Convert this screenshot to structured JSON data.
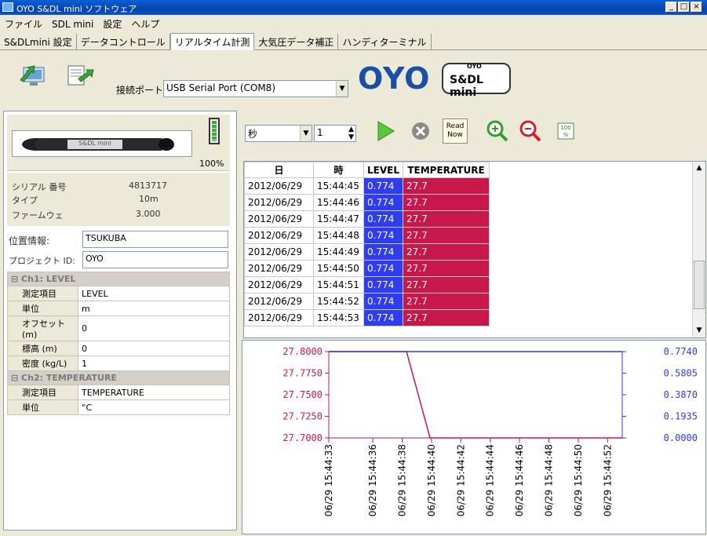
{
  "window": {
    "title": "OYO S&DL mini ソフトウェア",
    "buttons": [
      "_",
      "□",
      "×"
    ]
  },
  "menu": [
    "ファイル",
    "SDL mini",
    "設定",
    "ヘルプ"
  ],
  "tabs": [
    {
      "label": "S&DLmini 設定",
      "active": false
    },
    {
      "label": "データコントロール",
      "active": false
    },
    {
      "label": "リアルタイム計測",
      "active": true
    },
    {
      "label": "大気圧データ補正",
      "active": false
    },
    {
      "label": "ハンディターミナル",
      "active": false
    }
  ],
  "toolbar": {
    "port_label": "接続ポート",
    "port_value": "USB Serial Port (COM8)",
    "logo_text": "OYO",
    "badge_top": "OYO",
    "badge_text": "S&DL mini"
  },
  "device": {
    "battery": "100%",
    "image_label": "S&DL mini",
    "serial_label": "シリアル 番号",
    "serial": "4813717",
    "type_label": "タイプ",
    "type": "10m",
    "firmware_label": "ファームウェ",
    "firmware": "3.000",
    "location_label": "位置情報:",
    "location": "TSUKUBA",
    "project_label": "プロジェクト ID:",
    "project": "OYO"
  },
  "properties": [
    {
      "group": "Ch1: LEVEL"
    },
    {
      "name": "測定項目",
      "value": "LEVEL"
    },
    {
      "name": "単位",
      "value": "m"
    },
    {
      "name": "オフセット (m)",
      "value": "0"
    },
    {
      "name": "標高 (m)",
      "value": "0"
    },
    {
      "name": "密度 (kg/L)",
      "value": "1"
    },
    {
      "group": "Ch2: TEMPERATURE"
    },
    {
      "name": "測定項目",
      "value": "TEMPERATURE"
    },
    {
      "name": "単位",
      "value": "°C"
    }
  ],
  "controls": {
    "unit": "秒",
    "interval": "1",
    "read_now": "Read Now"
  },
  "table": {
    "headers": [
      "日",
      "時",
      "LEVEL",
      "TEMPERATURE"
    ],
    "rows": [
      [
        "2012/06/29",
        "15:44:45",
        "0.774",
        "27.7"
      ],
      [
        "2012/06/29",
        "15:44:46",
        "0.774",
        "27.7"
      ],
      [
        "2012/06/29",
        "15:44:47",
        "0.774",
        "27.7"
      ],
      [
        "2012/06/29",
        "15:44:48",
        "0.774",
        "27.7"
      ],
      [
        "2012/06/29",
        "15:44:49",
        "0.774",
        "27.7"
      ],
      [
        "2012/06/29",
        "15:44:50",
        "0.774",
        "27.7"
      ],
      [
        "2012/06/29",
        "15:44:51",
        "0.774",
        "27.7"
      ],
      [
        "2012/06/29",
        "15:44:52",
        "0.774",
        "27.7"
      ],
      [
        "2012/06/29",
        "15:44:53",
        "0.774",
        "27.7"
      ]
    ]
  },
  "colors": {
    "level": "#2f3cf0",
    "temperature": "#c8174a",
    "accent": "#1a4fa6"
  },
  "chart_data": {
    "type": "line",
    "left_ticks": [
      "27.8000",
      "27.7750",
      "27.7500",
      "27.7250",
      "27.7000"
    ],
    "right_ticks": [
      "0.7740",
      "0.5805",
      "0.3870",
      "0.1935",
      "0.0000"
    ],
    "x_ticks": [
      "06/29 15:44:33",
      "06/29 15:44:36",
      "06/29 15:44:38",
      "06/29 15:44:40",
      "06/29 15:44:42",
      "06/29 15:44:44",
      "06/29 15:44:46",
      "06/29 15:44:48",
      "06/29 15:44:50",
      "06/29 15:44:52"
    ],
    "x_range_seconds": [
      33,
      53
    ],
    "left_range": [
      27.7,
      27.8
    ],
    "right_range": [
      0,
      0.774
    ],
    "series": [
      {
        "axis": "left",
        "points": [
          [
            33,
            27.8
          ],
          [
            38.3,
            27.8
          ],
          [
            39.9,
            27.7
          ],
          [
            53,
            27.7
          ]
        ]
      },
      {
        "axis": "right",
        "points": [
          [
            33,
            0.774
          ],
          [
            53,
            0.774
          ]
        ]
      }
    ]
  }
}
